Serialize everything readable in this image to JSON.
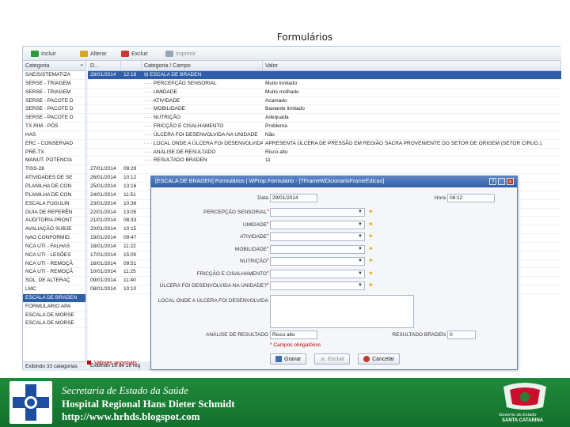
{
  "slide_title": "Formulários",
  "toolbar": {
    "incluir": "Incluir",
    "alterar": "Alterar",
    "excluir": "Excluir",
    "imprimir": "Imprimir"
  },
  "left_panel": {
    "header": "Categoria",
    "items": [
      "SAE/SISTEMATIZA",
      "SERSE - TRIAGEM",
      "SERSE - TRIAGEM",
      "SERSE - PACOTE D",
      "SERSE - PACOTE D",
      "SERSE - PACOTE D",
      "TX RIM - PÓS",
      "HAS",
      "ERC - CONSERVAD",
      "PRÉ-TX",
      "MANUT. POTENCIA",
      "TISS-28",
      "ATIVIDADES DE SE",
      "PLANILHA DE CON",
      "PLANILHA DE CON",
      "ESCALA FUGULIN",
      "GUIA DE REFERÊN",
      "AUDITORIA PRONT",
      "AVALIAÇÃO SUBJE",
      "NAO CONFORMID.",
      "NCA UTI - FALHAS",
      "NCA UTI - LESÕES",
      "NCA UTI - REMOÇÃ",
      "NCA UTI - REMOÇÃ",
      "SOL. DE ALTERAÇ",
      "LMC",
      "ESCALA DE BRADEN",
      "FORMULARIO APA",
      "ESCALA DE MORSE",
      "ESCALA DE MORSE"
    ],
    "selected_index": 26,
    "footer": "Exibindo 33 categorias"
  },
  "right_panel": {
    "headers": [
      "D...",
      "",
      "Categoria / Campo",
      "Valor"
    ],
    "rows": [
      [
        "28/01/2014",
        "12:18",
        "⊟ ESCALA DE BRADEN",
        ""
      ],
      [
        "",
        "",
        "· · · PERCEPÇÃO SENSORIAL",
        "Muito limitado"
      ],
      [
        "",
        "",
        "· · · UMIDADE",
        "Muito molhado"
      ],
      [
        "",
        "",
        "· · · ATIVIDADE",
        "Acamado"
      ],
      [
        "",
        "",
        "· · · MOBILIDADE",
        "Bastante limitado"
      ],
      [
        "",
        "",
        "· · · NUTRIÇÃO",
        "Adequada"
      ],
      [
        "",
        "",
        "· · · FRICÇÃO E CISALHAMENTO",
        "Problema"
      ],
      [
        "",
        "",
        "· · · ÚLCERA FOI DESENVOLVIDA NA UNIDADE",
        "Não"
      ],
      [
        "",
        "",
        "· · · LOCAL ONDE A ÚLCERA FOI DESENVOLVIDA",
        "APRESENTA ÚLCERA DE PRESSÃO EM REGIÃO SACRA PROVENIENTE DO SETOR DE ORIGEM (SETOR CIRUG.)."
      ],
      [
        "",
        "",
        "· · · ANÁLISE DE RESULTADO",
        "Risco alto"
      ],
      [
        "",
        "",
        "· · · RESULTADO BRADEN",
        "11"
      ],
      [
        "27/01/2014",
        "09:29",
        "",
        ""
      ],
      [
        "26/01/2014",
        "10:12",
        "",
        ""
      ],
      [
        "25/01/2014",
        "13:16",
        "",
        ""
      ],
      [
        "24/01/2014",
        "11:51",
        "",
        ""
      ],
      [
        "23/01/2014",
        "10:36",
        "",
        ""
      ],
      [
        "22/01/2014",
        "13:05",
        "",
        ""
      ],
      [
        "21/01/2014",
        "08:33",
        "",
        ""
      ],
      [
        "20/01/2014",
        "10:15",
        "",
        ""
      ],
      [
        "19/01/2014",
        "09:47",
        "",
        ""
      ],
      [
        "18/01/2014",
        "11:22",
        "",
        ""
      ],
      [
        "17/01/2014",
        "15:00",
        "",
        ""
      ],
      [
        "16/01/2014",
        "09:51",
        "",
        ""
      ],
      [
        "10/01/2014",
        "11:25",
        "",
        ""
      ],
      [
        "09/01/2014",
        "11:40",
        "",
        ""
      ],
      [
        "08/01/2014",
        "10:10",
        "",
        ""
      ]
    ],
    "footer": "Exibindo 16 de 16 reg",
    "alert": "Valores anormais"
  },
  "dialog": {
    "title": "[ESCALA DE BRADEN] Formulários | WProp.Formulario - [TFrameWDicionarioFrameEdicao]",
    "data_label": "Data",
    "data_value": "29/01/2014",
    "hora_label": "Hora",
    "hora_value": "08:12",
    "fields": [
      "PERCEPÇÃO SENSORIAL",
      "UMIDADE",
      "ATIVIDADE",
      "MOBILIDADE",
      "NUTRIÇÃO",
      "FRICÇÃO E CISALHAMENTO",
      "ÚLCERA FOI DESENVOLVIDA NA UNIDADE?"
    ],
    "local_label": "LOCAL ONDE A ÚLCERA FOI DESENVOLVIDA",
    "analise_label": "ANÁLISE DE RESULTADO",
    "analise_value": "Risco alto",
    "resultado_label": "RESULTADO BRADEN",
    "resultado_value": "0",
    "required_note": "* Campos obrigatórios",
    "btn_gravar": "Gravar",
    "btn_excluir": "Excluir",
    "btn_cancelar": "Cancelar"
  },
  "banner": {
    "line1": "Secretaria de Estado da Saúde",
    "line2": "Hospital Regional Hans Dieter Schmidt",
    "line3": "http://www.hrhds.blogspot.com",
    "gov1": "Governo do Estado",
    "gov2": "SANTA CATARINA"
  }
}
